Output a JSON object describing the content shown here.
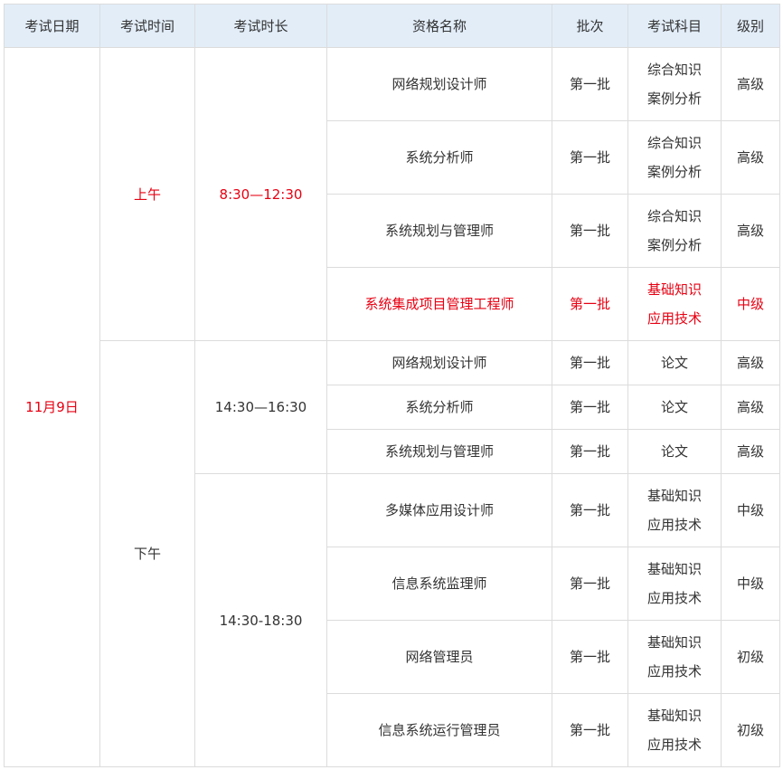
{
  "colors": {
    "header_bg": "#e2edf8",
    "highlight": "#e60012",
    "border": "#dcdcdc"
  },
  "headers": [
    "考试日期",
    "考试时间",
    "考试时长",
    "资格名称",
    "批次",
    "考试科目",
    "级别"
  ],
  "date": "11月9日",
  "morning": {
    "period": "上午",
    "duration": "8:30—12:30",
    "rows": [
      {
        "name": "网络规划设计师",
        "batch": "第一批",
        "subjects": [
          "综合知识",
          "案例分析"
        ],
        "level": "高级"
      },
      {
        "name": "系统分析师",
        "batch": "第一批",
        "subjects": [
          "综合知识",
          "案例分析"
        ],
        "level": "高级"
      },
      {
        "name": "系统规划与管理师",
        "batch": "第一批",
        "subjects": [
          "综合知识",
          "案例分析"
        ],
        "level": "高级"
      },
      {
        "name": "系统集成项目管理工程师",
        "batch": "第一批",
        "subjects": [
          "基础知识",
          "应用技术"
        ],
        "level": "中级"
      }
    ]
  },
  "afternoon": {
    "period": "下午",
    "block1": {
      "duration": "14:30—16:30",
      "rows": [
        {
          "name": "网络规划设计师",
          "batch": "第一批",
          "subjects": [
            "论文"
          ],
          "level": "高级"
        },
        {
          "name": "系统分析师",
          "batch": "第一批",
          "subjects": [
            "论文"
          ],
          "level": "高级"
        },
        {
          "name": "系统规划与管理师",
          "batch": "第一批",
          "subjects": [
            "论文"
          ],
          "level": "高级"
        }
      ]
    },
    "block2": {
      "duration": "14:30-18:30",
      "rows": [
        {
          "name": "多媒体应用设计师",
          "batch": "第一批",
          "subjects": [
            "基础知识",
            "应用技术"
          ],
          "level": "中级"
        },
        {
          "name": "信息系统监理师",
          "batch": "第一批",
          "subjects": [
            "基础知识",
            "应用技术"
          ],
          "level": "中级"
        },
        {
          "name": "网络管理员",
          "batch": "第一批",
          "subjects": [
            "基础知识",
            "应用技术"
          ],
          "level": "初级"
        },
        {
          "name": "信息系统运行管理员",
          "batch": "第一批",
          "subjects": [
            "基础知识",
            "应用技术"
          ],
          "level": "初级"
        }
      ]
    }
  }
}
